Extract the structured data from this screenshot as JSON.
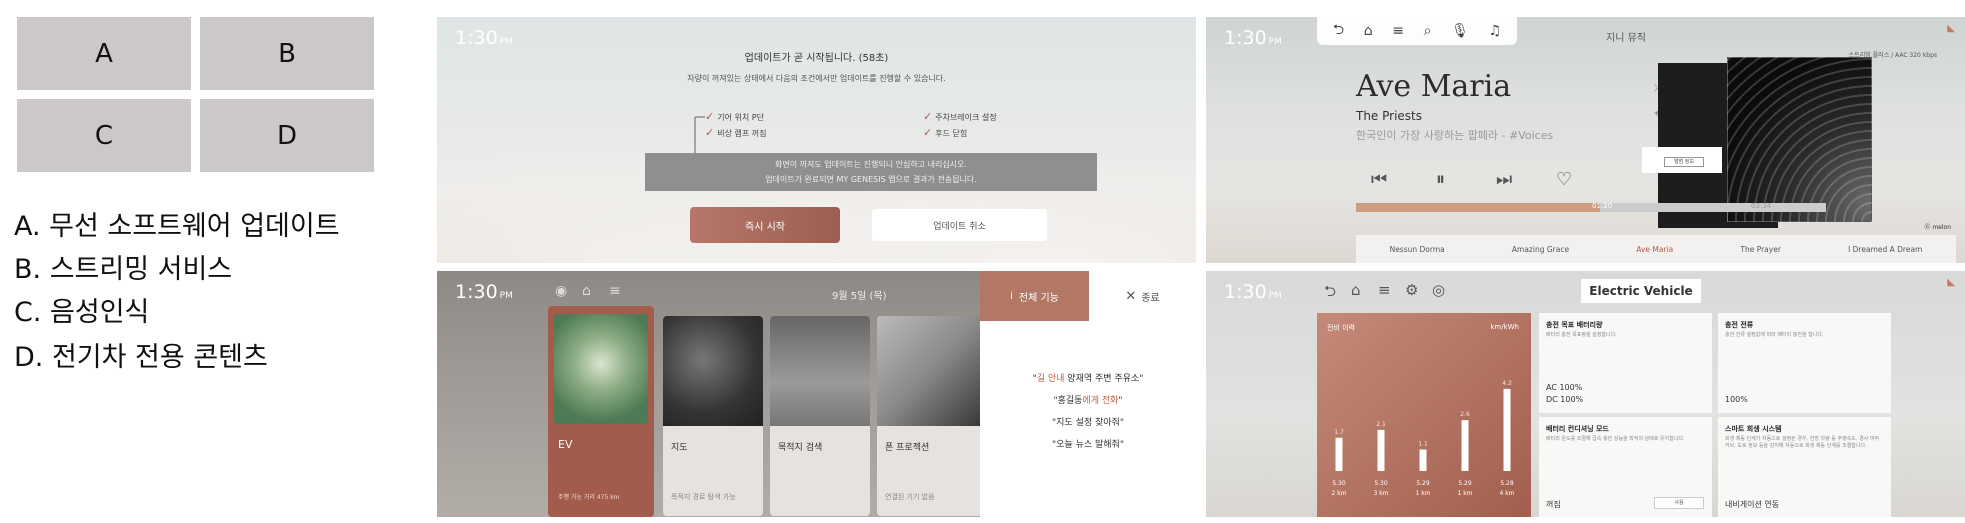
{
  "legend": {
    "cells": [
      "A",
      "B",
      "C",
      "D"
    ],
    "items": [
      "A. 무선 소프트웨어 업데이트",
      "B. 스트리밍 서비스",
      "C. 음성인식",
      "D. 전기차 전용 콘텐츠"
    ]
  },
  "panelA": {
    "time": "1:30",
    "ampm": "PM",
    "title": "업데이트가 곧 시작됩니다. (58초)",
    "subtitle": "차량이 꺼져있는 상태에서 다음의 조건에서만 업데이트를 진행할 수 있습니다.",
    "checks": [
      "기어 위치 P단",
      "주차브레이크 설정",
      "비상 램프 꺼짐",
      "후드 닫힘"
    ],
    "notice_line1": "화면이 꺼져도 업데이트는 진행되니 안심하고 내리십시오.",
    "notice_line2": "업데이트가 완료되면 MY GENESIS 앱으로 결과가 전송됩니다.",
    "start_button": "즉시 시작",
    "cancel_button": "업데이트 취소"
  },
  "panelB": {
    "time": "1:30",
    "ampm": "PM",
    "header": "지니 뮤직",
    "quality": "스트리밍 플러스 / AAC 320 kbps",
    "song": "Ave Maria",
    "artist": "The Priests",
    "subtitle": "한국인이 가장 사랑하는 팝페라 - #Voices",
    "elapsed": "01:20",
    "total": "03:34",
    "progress": 0.52,
    "queue": [
      "Nessun Dorma",
      "Amazing Grace",
      "Ave Maria",
      "The Prayer",
      "I Dreamed A Dream"
    ],
    "active_index": 2,
    "info_button": "앨범 정보",
    "brand": "Ⓖ melon",
    "toolbar_icons": [
      "back-icon",
      "home-icon",
      "menu-icon",
      "search-icon",
      "mic-icon",
      "playlist-icon"
    ]
  },
  "panelC": {
    "time": "1:30",
    "ampm": "PM",
    "date": "9월 5일 (목)",
    "side_header": "전체 기능",
    "close_label": "종료",
    "cards": [
      {
        "label": "EV",
        "desc": "주행 가능 거리 475 km"
      },
      {
        "label": "지도",
        "desc": "목적지 경로 탐색 가능"
      },
      {
        "label": "목적지 검색",
        "desc": ""
      },
      {
        "label": "폰 프로젝션",
        "desc": "연결된 기기 없음"
      }
    ],
    "voice_commands": [
      {
        "pre": "\"",
        "hl": "길 안내",
        "post": " 양재역 주변 주유소\""
      },
      {
        "pre": "\"홍길동",
        "hl": "에게 전화",
        "post": "\""
      },
      {
        "pre": "\"지도 설정 찾아줘\"",
        "hl": "",
        "post": ""
      },
      {
        "pre": "\"오늘 뉴스 말해줘\"",
        "hl": "",
        "post": ""
      }
    ]
  },
  "panelD": {
    "time": "1:30",
    "ampm": "PM",
    "title": "Electric Vehicle",
    "chart_title": "전비 이력",
    "chart_unit": "km/kWh",
    "cards": [
      {
        "heading": "충전 목표 배터리량",
        "desc": "배터리 충전 목표량을 설정합니다.",
        "values": [
          "AC 100%",
          "DC 100%"
        ]
      },
      {
        "heading": "충전 전류",
        "desc": "충전 전류 설정값에 따라 배터리 충전을 합니다.",
        "values": [
          "100%"
        ]
      },
      {
        "heading": "배터리 컨디셔닝 모드",
        "desc": "배터리 온도를 조절해 급속 충전 성능을 최적의 상태로 유지합니다.",
        "values": [
          "꺼짐"
        ],
        "toggle": "사용"
      },
      {
        "heading": "스마트 회생 시스템",
        "desc": "회생 제동 단계가 자동으로 설정된 경우, 전방 차량 등 주행속도, 경사 여부, 커브, 도로 정보 등을 감지해 자동으로 회생 제동 단계를 조절합니다.",
        "values": [
          "내비게이션 연동"
        ]
      }
    ]
  },
  "chart_data": {
    "type": "bar",
    "title": "전비 이력",
    "ylabel": "km/kWh",
    "categories": [
      "5.30 2 km",
      "5.30 3 km",
      "5.29 1 km",
      "5.29 1 km",
      "5.28 4 km"
    ],
    "cat_date": [
      "5.30",
      "5.30",
      "5.29",
      "5.29",
      "5.28"
    ],
    "cat_dist": [
      "2 km",
      "3 km",
      "1 km",
      "1 km",
      "4 km"
    ],
    "values": [
      1.7,
      2.1,
      1.1,
      2.6,
      4.2
    ],
    "ylim": [
      0,
      4.5
    ]
  }
}
